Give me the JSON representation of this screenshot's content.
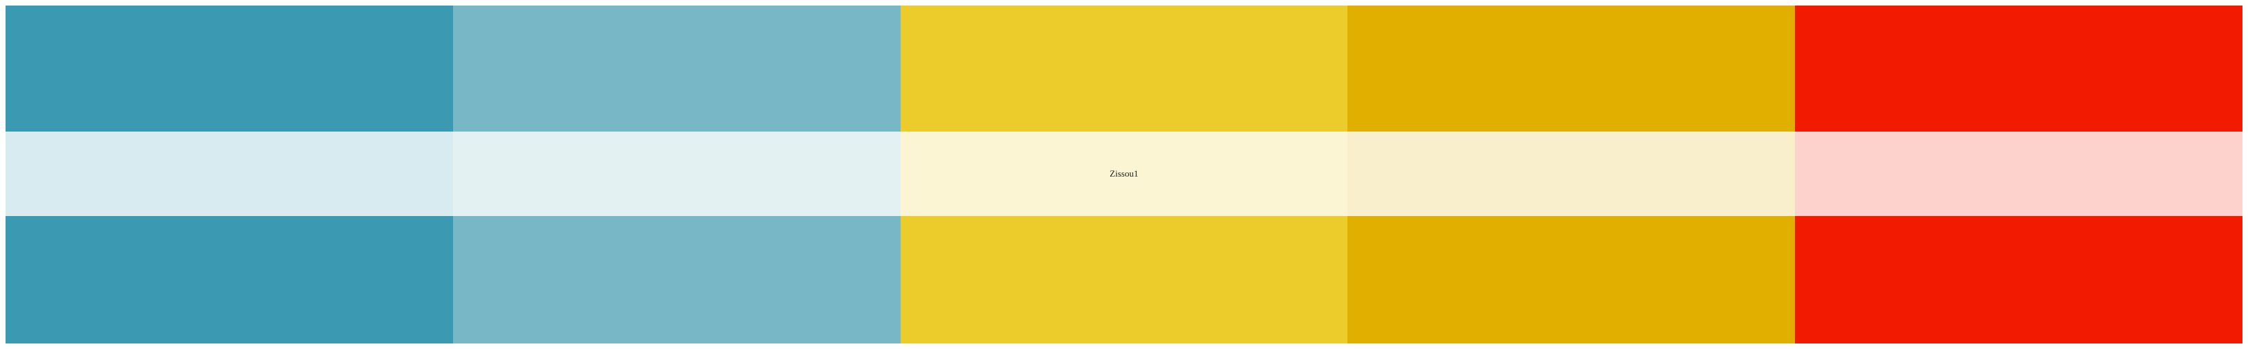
{
  "palette": {
    "caption": "Zissou1",
    "swatches": [
      {
        "color": "#3B9AB2",
        "tint": "#D8EBF0"
      },
      {
        "color": "#78B7C5",
        "tint": "#E4F1F3"
      },
      {
        "color": "#EBCC2A",
        "tint": "#FBF5D4"
      },
      {
        "color": "#E1AF00",
        "tint": "#F9EFCC"
      },
      {
        "color": "#F21A00",
        "tint": "#FDD1CC"
      }
    ]
  }
}
